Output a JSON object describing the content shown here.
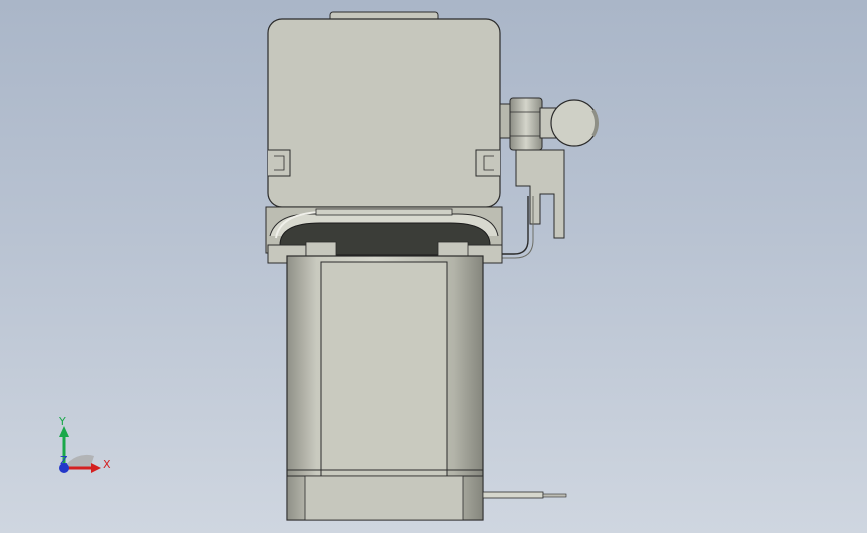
{
  "viewport": {
    "background_top": "#aab6c8",
    "background_bottom": "#cfd6e0"
  },
  "model": {
    "body_color": "#c6c7bd",
    "edge_color": "#2b2b2b",
    "dark_cavity_color": "#3b3d38",
    "shade_color": "#9fa095"
  },
  "triad": {
    "x_label": "X",
    "y_label": "Y",
    "z_label": "Z",
    "x_color": "#d42020",
    "y_color": "#1aa84a",
    "z_color": "#2337c9"
  }
}
